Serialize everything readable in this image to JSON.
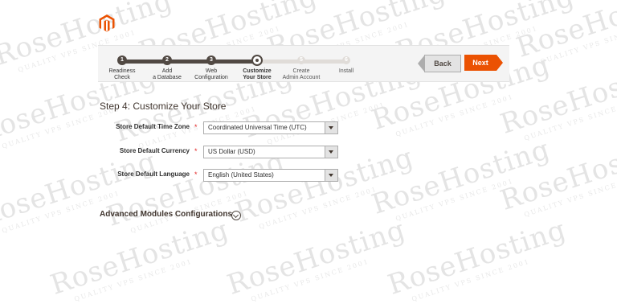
{
  "watermark": {
    "brand": "RoseHosting",
    "tagline": "QUALITY VPS SINCE 2001"
  },
  "brand": {
    "logo_icon": "magento-logo-icon",
    "accent": "#eb5202"
  },
  "wizard": {
    "steps": [
      {
        "label_line1": "Readiness",
        "label_line2": "Check",
        "number": "1",
        "state": "done"
      },
      {
        "label_line1": "Add",
        "label_line2": "a Database",
        "number": "2",
        "state": "done"
      },
      {
        "label_line1": "Web",
        "label_line2": "Configuration",
        "number": "3",
        "state": "done"
      },
      {
        "label_line1": "Customize",
        "label_line2": "Your Store",
        "number": "4",
        "state": "current"
      },
      {
        "label_line1": "Create",
        "label_line2": "Admin Account",
        "number": "5",
        "state": "todo"
      },
      {
        "label_line1": "Install",
        "label_line2": "",
        "number": "6",
        "state": "todo"
      }
    ],
    "back_label": "Back",
    "next_label": "Next"
  },
  "form": {
    "title": "Step 4: Customize Your Store",
    "fields": [
      {
        "label": "Store Default Time Zone",
        "value": "Coordinated Universal Time (UTC)"
      },
      {
        "label": "Store Default Currency",
        "value": "US Dollar (USD)"
      },
      {
        "label": "Store Default Language",
        "value": "English (United States)"
      }
    ],
    "required_marker": "*"
  },
  "advanced": {
    "title": "Advanced Modules Configurations",
    "toggle_icon": "chevron-down-circle-icon"
  }
}
